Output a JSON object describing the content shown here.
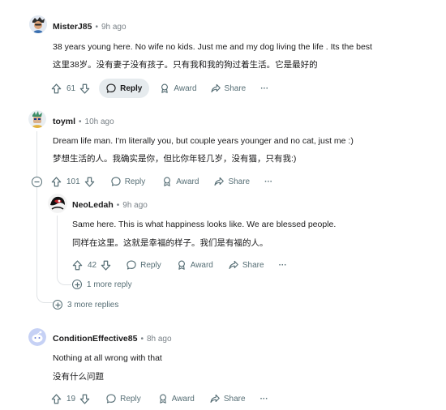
{
  "comments": [
    {
      "author": "MisterJ85",
      "time": "9h ago",
      "text_en": "38 years young here. No wife no kids. Just me and my dog living the life . Its the best",
      "text_zh": "这里38岁。没有妻子没有孩子。只有我和我的狗过着生活。它是最好的",
      "score": "61",
      "reply_label": "Reply",
      "award_label": "Award",
      "share_label": "Share",
      "more_glyph": "···"
    },
    {
      "author": "toyml",
      "time": "10h ago",
      "text_en": "Dream life man. I'm literally you, but couple years younger and no cat, just me :)",
      "text_zh": "梦想生活的人。我确实是你，但比你年轻几岁，没有猫，只有我:)",
      "score": "101",
      "reply_label": "Reply",
      "award_label": "Award",
      "share_label": "Share",
      "more_glyph": "···",
      "more_replies": "3 more replies"
    },
    {
      "author": "NeoLedah",
      "time": "9h ago",
      "text_en": "Same here. This is what happiness looks like. We are blessed people.",
      "text_zh": "同样在这里。这就是幸福的样子。我们是有福的人。",
      "score": "42",
      "reply_label": "Reply",
      "award_label": "Award",
      "share_label": "Share",
      "more_glyph": "···",
      "more_replies": "1 more reply"
    },
    {
      "author": "ConditionEffective85",
      "time": "8h ago",
      "text_en": "Nothing at all wrong with that",
      "text_zh": "没有什么问题",
      "score": "19",
      "reply_label": "Reply",
      "award_label": "Award",
      "share_label": "Share",
      "more_glyph": "···"
    }
  ],
  "separator": "•",
  "icons": {
    "upvote": "upvote-icon",
    "downvote": "downvote-icon",
    "reply": "comment-bubble-icon",
    "award": "award-icon",
    "share": "share-icon",
    "collapse": "minus-circle-icon",
    "expand": "plus-circle-icon"
  },
  "colors": {
    "text": "#1a1a1b",
    "meta": "#7a8288",
    "action": "#576f76",
    "reply_active_bg": "#e6ebee",
    "thread_line": "#e0e3e6"
  }
}
